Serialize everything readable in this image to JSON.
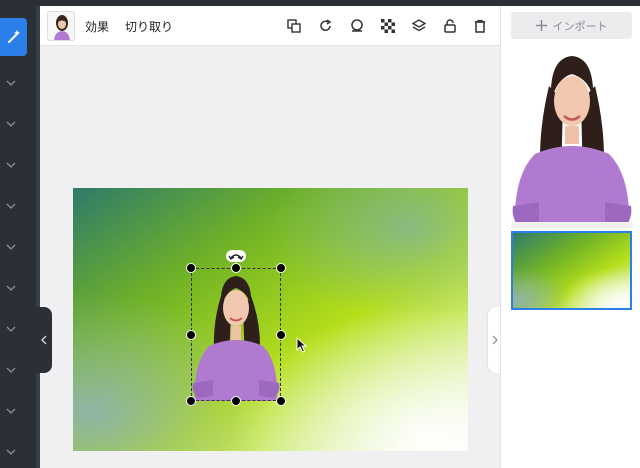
{
  "toolbar": {
    "effects_label": "効果",
    "crop_label": "切り取り",
    "icons": [
      "duplicate-icon",
      "redo-icon",
      "mask-icon",
      "transparency-icon",
      "layers-icon",
      "lock-icon",
      "trash-icon"
    ]
  },
  "right_panel": {
    "import_label": "インポート",
    "import_icon": "plus-icon"
  },
  "rail": {
    "active_tool_icon": "magic-wand-icon",
    "collapsed_sections": 9
  },
  "colors": {
    "accent": "#2b7fe8",
    "rail_bg": "#2b2f36",
    "canvas_green": "#8fd21a",
    "shirt_purple": "#b07ad0"
  }
}
